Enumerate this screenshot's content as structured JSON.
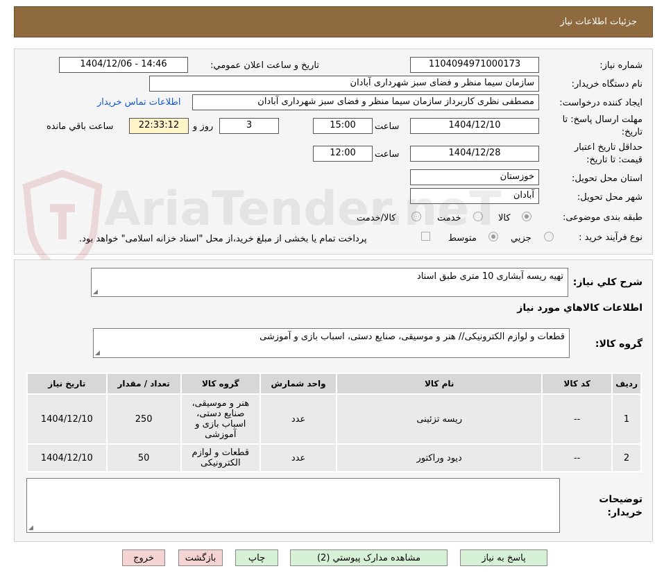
{
  "header": {
    "title": "جزئیات اطلاعات نیاز"
  },
  "form": {
    "need_number_label": "شماره نیاز:",
    "need_number": "1104094971000173",
    "announce_label": "تاریخ و ساعت اعلان عمومي:",
    "announce_value": "1404/12/06 - 14:46",
    "buyer_org_label": "نام دستگاه خریدار:",
    "buyer_org": "سازمان سیما منظر و فضای سبز شهرداری آبادان",
    "creator_label": "ایجاد کننده درخواست:",
    "creator": "مصطفی نظری کاربرداز سازمان سیما منظر و فضای سبز شهرداری آبادان",
    "contact_link": "اطلاعات تماس خریدار",
    "deadline_label_1": "مهلت ارسال پاسخ: تا",
    "deadline_label_2": "تاریخ:",
    "deadline_date": "1404/12/10",
    "time_label": "ساعت",
    "deadline_time": "15:00",
    "days": "3",
    "days_label": "روز و",
    "remaining": "22:33:12",
    "remaining_label": "ساعت باقي مانده",
    "validity_label_1": "حداقل تاریخ اعتبار",
    "validity_label_2": "قیمت: تا تاریخ:",
    "validity_date": "1404/12/28",
    "validity_time": "12:00",
    "province_label": "استان محل تحویل:",
    "province": "خوزستان",
    "city_label": "شهر محل تحویل:",
    "city": "آبادان",
    "category_label": "طبقه بندی موضوعی:",
    "category_options": [
      "کالا",
      "خدمت",
      "کالا/خدمت"
    ],
    "process_label": "نوع فرآیند خرید :",
    "process_options": [
      "جزیي",
      "متوسط"
    ],
    "payment_note": "پرداخت تمام یا بخشی از مبلغ خرید،از محل \"اسناد خزانه اسلامی\" خواهد بود."
  },
  "summary": {
    "desc_label": "شرح کلي نیاز:",
    "desc_value": "تهیه ریسه آبشاری 10 متری  طبق اسناد",
    "items_title": "اطلاعات کالاهاي مورد نیاز",
    "group_label": "گروه کالا:",
    "group_value": "قطعات و لوازم الکترونیکی// هنر و موسیقی، صنایع دستی، اسباب بازی و آموزشی"
  },
  "table": {
    "headers": [
      "ردیف",
      "کد کالا",
      "نام کالا",
      "واحد شمارش",
      "گروه کالا",
      "تعداد / مقدار",
      "تاریخ نیاز"
    ],
    "rows": [
      [
        "1",
        "--",
        "ریسه تزئینی",
        "عدد",
        "هنر و موسیقی، صنایع دستی، اسباب بازی و آموزشی",
        "250",
        "1404/12/10"
      ],
      [
        "2",
        "--",
        "دیود وراکتور",
        "عدد",
        "قطعات و لوازم الکترونیکی",
        "50",
        "1404/12/10"
      ]
    ]
  },
  "notes": {
    "label_1": "توضیحات",
    "label_2": "خریدار:"
  },
  "buttons": {
    "reply": "پاسخ به نیاز",
    "attachments": "مشاهده مدارک پیوستي (2)",
    "print": "چاپ",
    "back": "بازگشت",
    "exit": "خروج"
  },
  "watermark": {
    "text": "AriaTender.neT"
  },
  "colors": {
    "header": "#8e6a3e",
    "button_green": "#d7f1d7",
    "button_pink": "#f6d3d3",
    "link": "#1155cc"
  }
}
